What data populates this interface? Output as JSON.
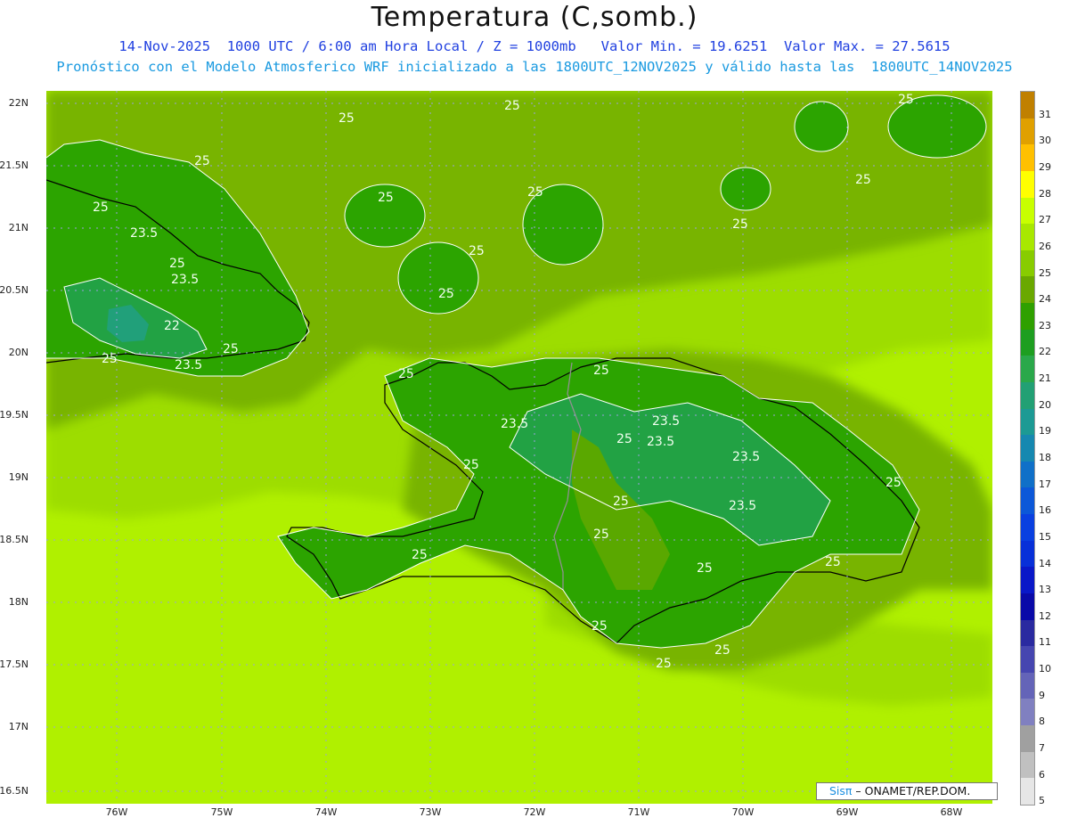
{
  "header": {
    "title": "Temperatura (C,somb.)",
    "line1": "14-Nov-2025  1000 UTC / 6:00 am Hora Local / Z = 1000mb   Valor Min. = 19.6251  Valor Max. = 27.5615",
    "line2": "Pronóstico con el Modelo Atmosferico WRF inicializado a las 1800UTC_12NOV2025 y válido hasta las  1800UTC_14NOV2025"
  },
  "axes": {
    "lat_labels": [
      "22N",
      "21.5N",
      "21N",
      "20.5N",
      "20N",
      "19.5N",
      "19N",
      "18.5N",
      "18N",
      "17.5N",
      "17N",
      "16.5N"
    ],
    "lon_labels": [
      "76W",
      "75W",
      "74W",
      "73W",
      "72W",
      "71W",
      "70W",
      "69W",
      "68W"
    ]
  },
  "colorbar": {
    "labels": [
      "31",
      "30",
      "29",
      "28",
      "27",
      "26",
      "25",
      "24",
      "23",
      "22",
      "21",
      "20",
      "19",
      "18",
      "17",
      "16",
      "15",
      "14",
      "13",
      "12",
      "11",
      "10",
      "9",
      "8",
      "7",
      "6",
      "5"
    ],
    "colors": [
      "#c08000",
      "#e0a000",
      "#ffc000",
      "#ffff00",
      "#c8ff00",
      "#a8e800",
      "#88cc00",
      "#6aa800",
      "#2fa000",
      "#1e9e20",
      "#2aa84a",
      "#22a074",
      "#1c9a94",
      "#1688b0",
      "#1070c8",
      "#0c58d8",
      "#0a40e0",
      "#0830d8",
      "#0a18c8",
      "#0a0aa8",
      "#2a2aa0",
      "#4646b0",
      "#6464b8",
      "#8080c0",
      "#a0a0a0",
      "#c0c0c0",
      "#e6e6e6"
    ]
  },
  "contour_labels": [
    {
      "text": "25"
    },
    {
      "text": "25"
    },
    {
      "text": "25"
    },
    {
      "text": "25"
    },
    {
      "text": "25"
    },
    {
      "text": "23.5"
    },
    {
      "text": "25"
    },
    {
      "text": "23.5"
    },
    {
      "text": "22"
    },
    {
      "text": "25"
    },
    {
      "text": "23.5"
    },
    {
      "text": "25"
    },
    {
      "text": "25"
    },
    {
      "text": "25"
    },
    {
      "text": "25"
    },
    {
      "text": "25"
    },
    {
      "text": "25"
    },
    {
      "text": "23.5"
    },
    {
      "text": "23.5"
    },
    {
      "text": "23.5"
    },
    {
      "text": "25"
    },
    {
      "text": "25"
    },
    {
      "text": "23.5"
    },
    {
      "text": "25"
    },
    {
      "text": "25"
    },
    {
      "text": "23.5"
    },
    {
      "text": "25"
    },
    {
      "text": "25"
    },
    {
      "text": "25"
    },
    {
      "text": "25"
    },
    {
      "text": "25"
    },
    {
      "text": "25"
    },
    {
      "text": "25"
    },
    {
      "text": "25"
    },
    {
      "text": "25"
    },
    {
      "text": "25"
    }
  ],
  "credit": {
    "brand": "Sisπ",
    "text": " – ONAMET/REP.DOM."
  }
}
